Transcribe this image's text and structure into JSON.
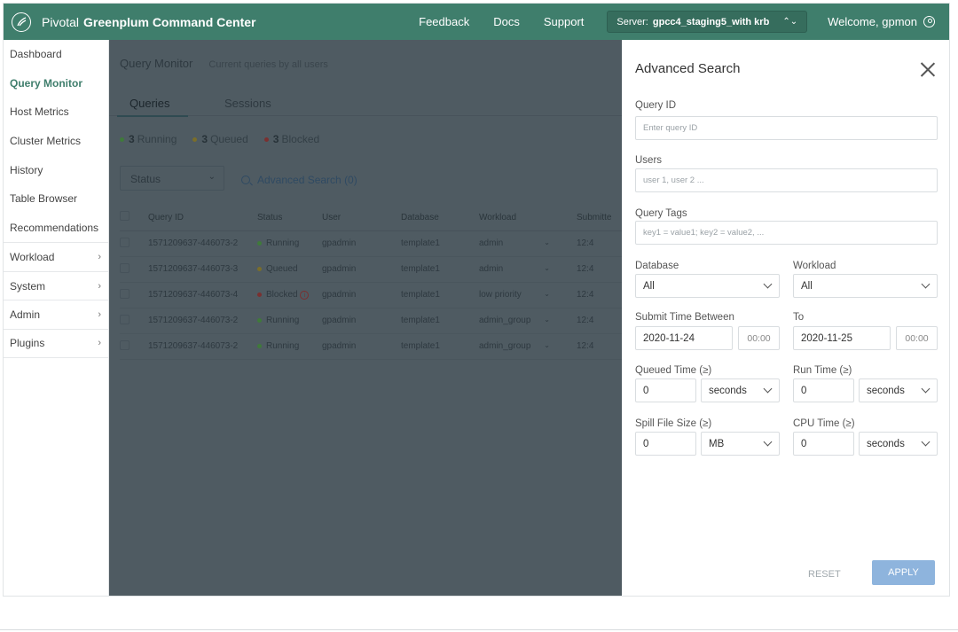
{
  "header": {
    "brand_light": "Pivotal",
    "brand_bold": "Greenplum Command Center",
    "nav": [
      "Feedback",
      "Docs",
      "Support"
    ],
    "server_label": "Server:",
    "server_value": "gpcc4_staging5_with krb",
    "welcome": "Welcome, gpmon"
  },
  "sidebar": {
    "items": [
      {
        "label": "Dashboard"
      },
      {
        "label": "Query Monitor"
      },
      {
        "label": "Host Metrics"
      },
      {
        "label": "Cluster Metrics"
      },
      {
        "label": "History"
      },
      {
        "label": "Table Browser"
      },
      {
        "label": "Recommendations"
      },
      {
        "label": "Workload"
      },
      {
        "label": "System"
      },
      {
        "label": "Admin"
      },
      {
        "label": "Plugins"
      }
    ],
    "active_index": 1
  },
  "main": {
    "title": "Query Monitor",
    "subtitle": "Current queries by all users",
    "tabs": [
      "Queries",
      "Sessions"
    ],
    "counts": [
      {
        "num": "3",
        "label": "Running",
        "color": "#3f7a3a"
      },
      {
        "num": "3",
        "label": "Queued",
        "color": "#7a6e2a"
      },
      {
        "num": "3",
        "label": "Blocked",
        "color": "#7a3030"
      }
    ],
    "status_filter": "Status",
    "advanced_search": "Advanced Search (0)",
    "columns": [
      "Query ID",
      "Status",
      "User",
      "Database",
      "Workload",
      "Submitte"
    ],
    "rows": [
      {
        "id": "1571209637-446073-2",
        "status": "Running",
        "status_color": "#3f7a3a",
        "user": "gpadmin",
        "db": "template1",
        "workload": "admin",
        "time": "12:4"
      },
      {
        "id": "1571209637-446073-3",
        "status": "Queued",
        "status_color": "#7a6e2a",
        "user": "gpadmin",
        "db": "template1",
        "workload": "admin",
        "time": "12:4"
      },
      {
        "id": "1571209637-446073-4",
        "status": "Blocked",
        "status_color": "#7a3030",
        "user": "gpadmin",
        "db": "template1",
        "workload": "low priority",
        "time": "12:4"
      },
      {
        "id": "1571209637-446073-2",
        "status": "Running",
        "status_color": "#3f7a3a",
        "user": "gpadmin",
        "db": "template1",
        "workload": "admin_group",
        "time": "12:4"
      },
      {
        "id": "1571209637-446073-2",
        "status": "Running",
        "status_color": "#3f7a3a",
        "user": "gpadmin",
        "db": "template1",
        "workload": "admin_group",
        "time": "12:4"
      }
    ]
  },
  "panel": {
    "title": "Advanced Search",
    "query_id_label": "Query ID",
    "query_id_placeholder": "Enter query ID",
    "users_label": "Users",
    "users_placeholder": "user 1, user 2 ...",
    "tags_label": "Query Tags",
    "tags_placeholder": "key1 = value1; key2 = value2, ...",
    "database_label": "Database",
    "database_value": "All",
    "workload_label": "Workload",
    "workload_value": "All",
    "submit_label": "Submit Time Between",
    "submit_from_date": "2020-11-24",
    "submit_from_time": "00:00",
    "to_label": "To",
    "submit_to_date": "2020-11-25",
    "submit_to_time": "00:00",
    "queued_label": "Queued Time (≥)",
    "queued_value": "0",
    "queued_unit": "seconds",
    "run_label": "Run Time (≥)",
    "run_value": "0",
    "run_unit": "seconds",
    "spill_label": "Spill File Size (≥)",
    "spill_value": "0",
    "spill_unit": "MB",
    "cpu_label": "CPU Time (≥)",
    "cpu_value": "0",
    "cpu_unit": "seconds",
    "reset": "RESET",
    "apply": "APPLY"
  },
  "colors": {
    "header": "#3f7e6c",
    "active_nav": "#3f7e6c",
    "apply_button": "#8eb4dd"
  }
}
